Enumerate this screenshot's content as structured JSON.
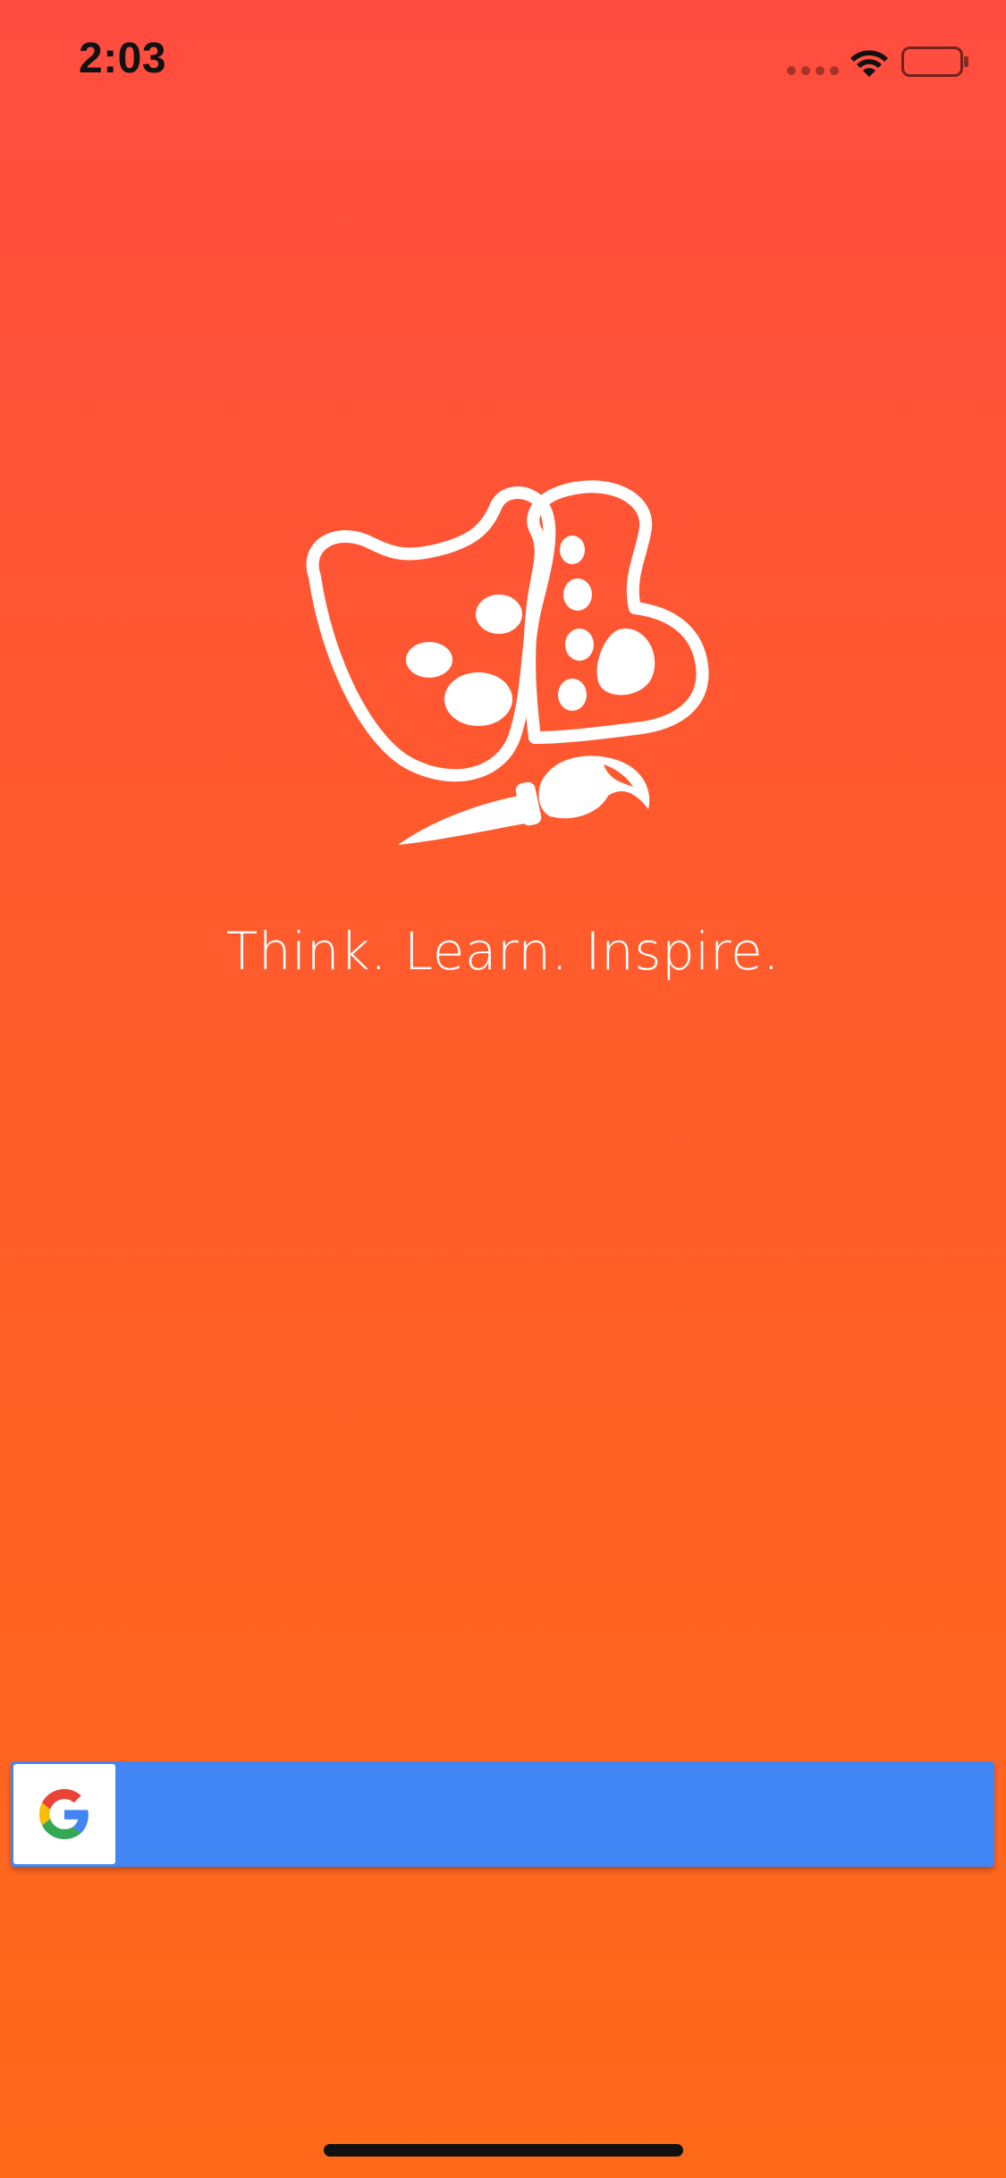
{
  "status_bar": {
    "time": "2:03",
    "icons": [
      "signal-icon",
      "wifi-icon",
      "battery-icon"
    ]
  },
  "app": {
    "logo": "palette-brush-logo",
    "tagline": "Think. Learn. Inspire."
  },
  "google_button": {
    "icon": "google-g-icon",
    "label": ""
  },
  "colors": {
    "background_top": "#ff4c40",
    "background_bottom": "#ff6a1a",
    "google_blue": "#4285f4"
  }
}
